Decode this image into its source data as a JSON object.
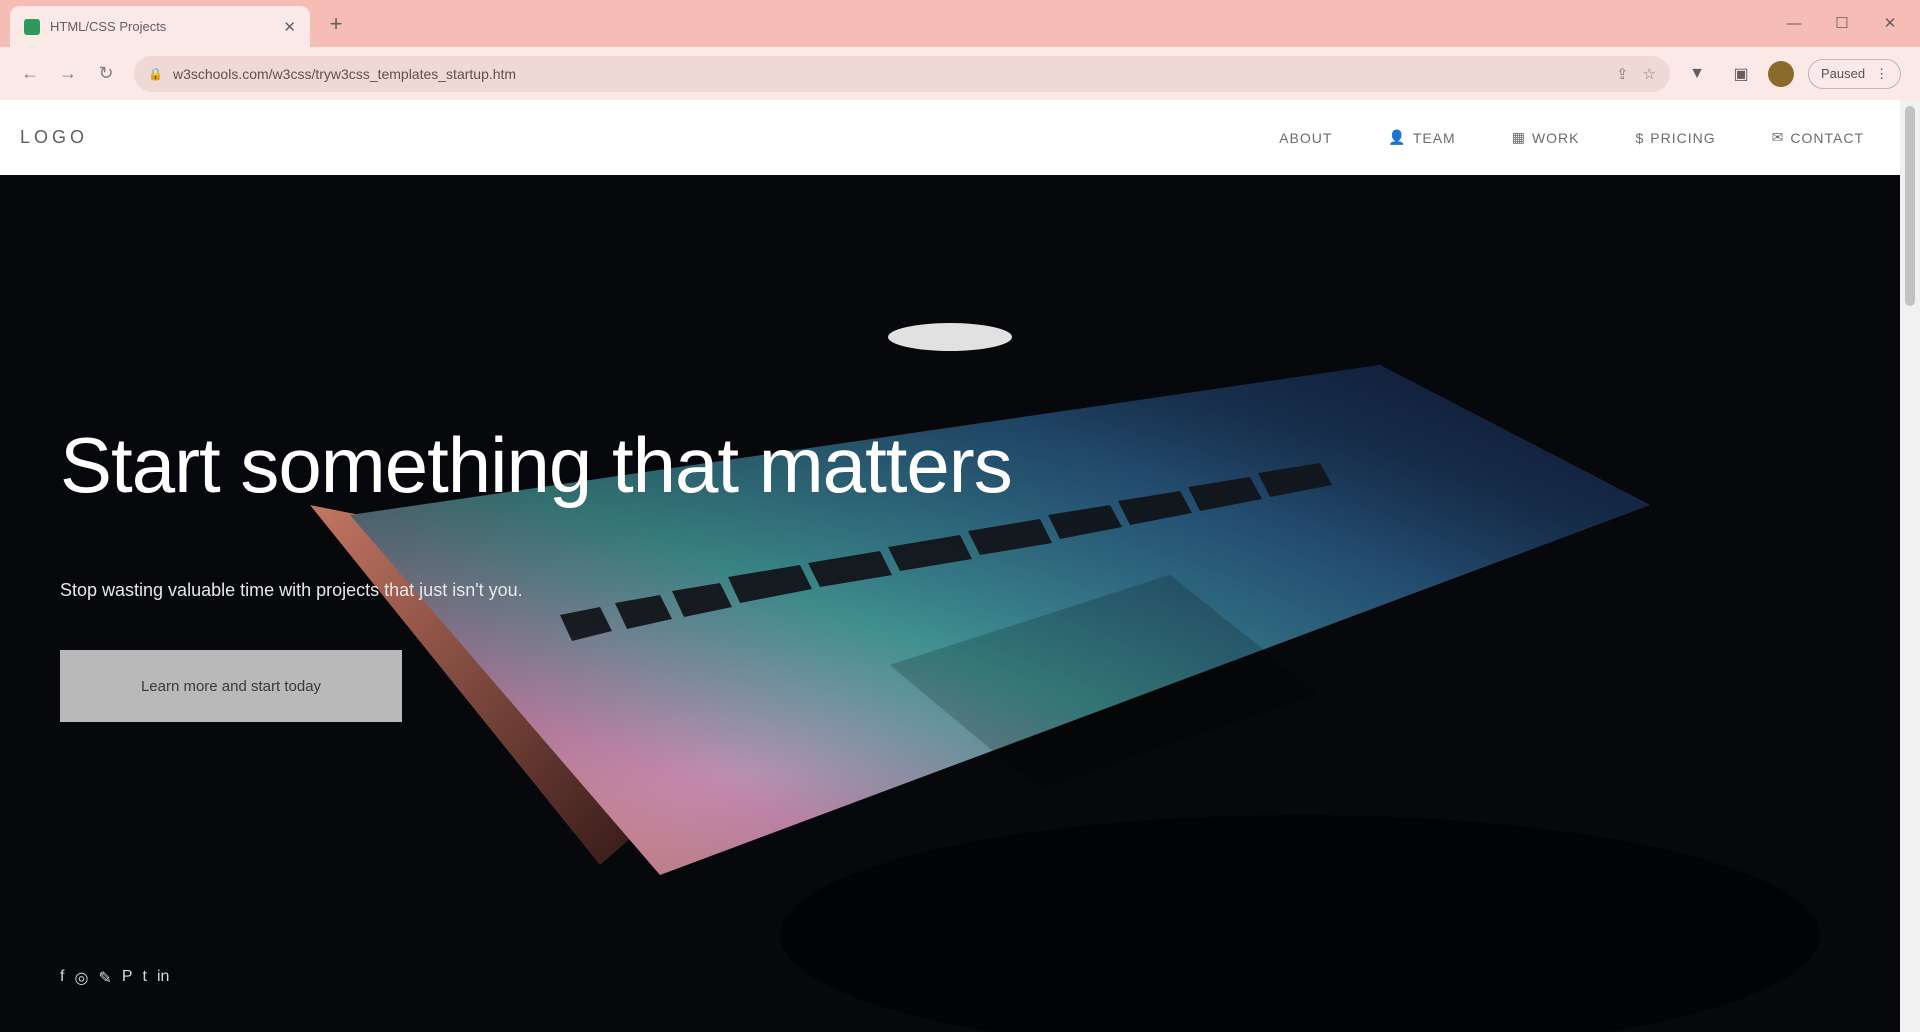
{
  "browser": {
    "tab": {
      "title": "HTML/CSS Projects",
      "close": "✕"
    },
    "new_tab": "+",
    "window_controls": {
      "minimize": "—",
      "maximize": "☐",
      "close": "✕"
    },
    "nav": {
      "back": "←",
      "forward": "→",
      "reload": "↻"
    },
    "url": "w3schools.com/w3css/tryw3css_templates_startup.htm",
    "extension_pill": {
      "label": "Paused",
      "menu": "⋮"
    }
  },
  "site": {
    "logo": "LOGO",
    "nav": [
      {
        "label": "ABOUT",
        "icon": ""
      },
      {
        "label": "TEAM",
        "icon": "👤"
      },
      {
        "label": "WORK",
        "icon": "▦"
      },
      {
        "label": "PRICING",
        "icon": "$"
      },
      {
        "label": "CONTACT",
        "icon": "✉"
      }
    ]
  },
  "hero": {
    "title": "Start something that matters",
    "subtitle": "Stop wasting valuable time with projects that just isn't you.",
    "cta": "Learn more and start today",
    "socials": [
      "f",
      "◎",
      "✎",
      "P",
      "t",
      "in"
    ]
  },
  "colors": {
    "tabbar": "#f6bdb6",
    "toolbar": "#fbe9e7",
    "hero_bg": "#07080b",
    "cta_bg": "#b9b9b9"
  }
}
